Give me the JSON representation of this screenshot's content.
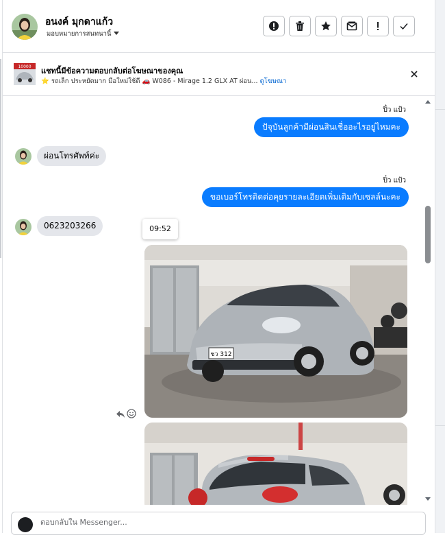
{
  "contact": {
    "name": "อนงค์ มุกดาแก้ว",
    "assign_label": "มอบหมายการสนทนานี้"
  },
  "toolbar": {
    "buttons": [
      {
        "name": "spam-button",
        "icon": "alert-circle-icon"
      },
      {
        "name": "delete-button",
        "icon": "trash-icon"
      },
      {
        "name": "star-button",
        "icon": "star-icon"
      },
      {
        "name": "mark-unread-button",
        "icon": "envelope-icon"
      },
      {
        "name": "follow-up-button",
        "icon": "exclamation-icon"
      },
      {
        "name": "done-button",
        "icon": "check-icon"
      }
    ]
  },
  "ad_banner": {
    "title": "แชทนี้มีข้อความตอบกลับต่อโฆษณาของคุณ",
    "subtitle": "⭐ รถเล็ก ประหยัดมาก มือใหม่ใช้ดี 🚗 W086 - Mirage 1.2 GLX AT ผ่อน...",
    "link": "ดูโฆษณา",
    "thumb_text": "10000"
  },
  "messages": [
    {
      "direction": "out",
      "sender": "ปิ๋ว แป้ว",
      "text": "ปัจุบันลูกค้ามีผ่อนสินเชื่ออะไรอยู่ไหมคะ"
    },
    {
      "direction": "in",
      "text": "ผ่อนโทรศัพท์ค่ะ"
    },
    {
      "direction": "out",
      "sender": "ปิ๋ว แป้ว",
      "text": "ขอเบอร์โทรติดต่อคุยรายละเอียดเพิ่มเติมกับเซลล์นะคะ"
    },
    {
      "direction": "in",
      "text": "0623203266"
    }
  ],
  "timestamp_tooltip": "09:52",
  "photo": {
    "plate_text": "ชว 312"
  },
  "composer": {
    "placeholder": "ตอบกลับใน Messenger..."
  },
  "colors": {
    "outgoing_bubble": "#0a7cff",
    "incoming_bubble": "#e4e6eb",
    "link": "#0064d1"
  }
}
